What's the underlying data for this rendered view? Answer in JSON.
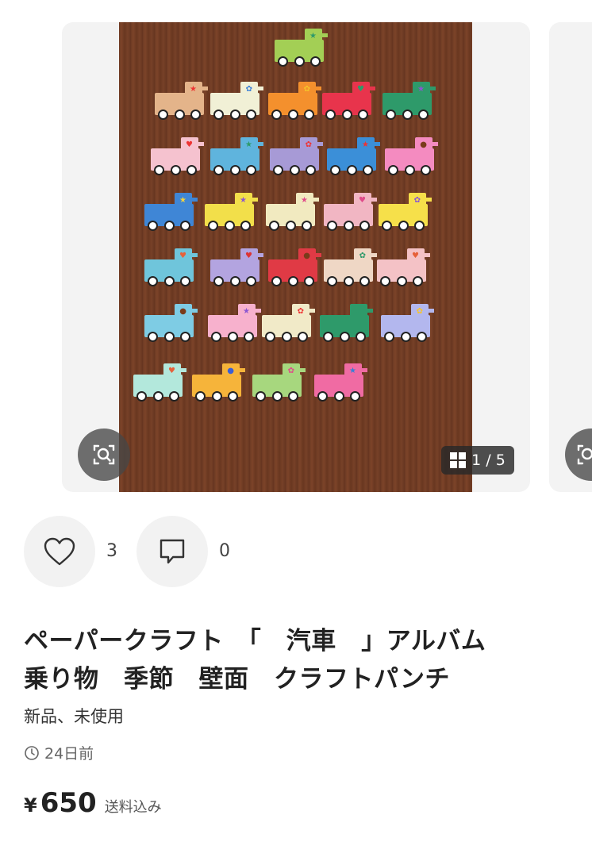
{
  "gallery": {
    "counter": "1 / 5",
    "photo_colors": {
      "palette": [
        "#a3cf55",
        "#e4b48a",
        "#f1f0d6",
        "#f4902d",
        "#e8344c",
        "#2e9a6a",
        "#f5c2cf",
        "#5fb4dd",
        "#a79ad6",
        "#3b8fd8",
        "#f48bc0",
        "#3f86d6",
        "#f2df4a",
        "#f1eac0",
        "#f1b6c3",
        "#f6e04a",
        "#6fc5db",
        "#b3a4e0",
        "#e03a45",
        "#efd7c5",
        "#f4c2c6",
        "#7ecce4",
        "#f7b1cd",
        "#f1eac8",
        "#2e9a6a",
        "#b3b7ee",
        "#b3e8dc",
        "#f6b43a",
        "#a7d77e",
        "#f06ba3"
      ]
    }
  },
  "actions": {
    "like_count": "3",
    "comment_count": "0"
  },
  "item": {
    "title": "ペーパークラフト　「　汽車　」アルバム\n乗り物　季節　壁面　クラフトパンチ",
    "condition": "新品、未使用",
    "posted": "24日前",
    "price_symbol": "¥",
    "price": "650",
    "shipping": "送料込み"
  },
  "icons": [
    "zoom-icon",
    "grid-icon",
    "heart-icon",
    "comment-icon",
    "clock-icon"
  ]
}
